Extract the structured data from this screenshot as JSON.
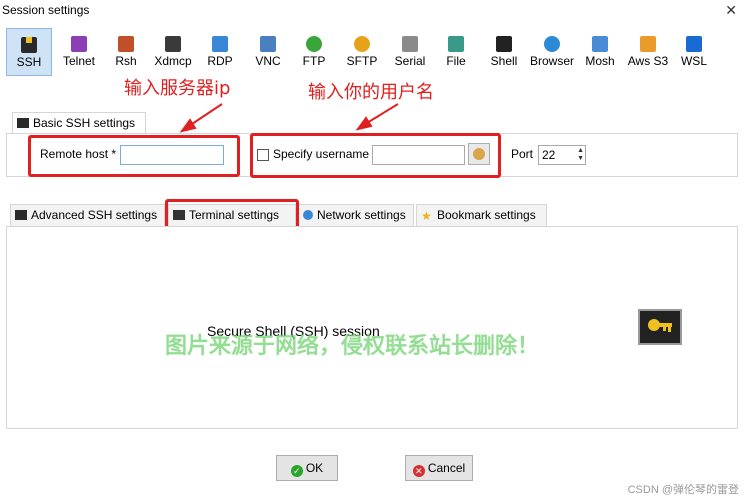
{
  "window": {
    "title": "Session settings",
    "close": "✕"
  },
  "session_types": [
    {
      "label": "SSH",
      "icon": "ssh-icon",
      "color": "#2a2a2a",
      "active": true
    },
    {
      "label": "Telnet",
      "icon": "telnet-icon",
      "color": "#8a3fb5"
    },
    {
      "label": "Rsh",
      "icon": "rsh-icon",
      "color": "#c0502a"
    },
    {
      "label": "Xdmcp",
      "icon": "xdmcp-icon",
      "color": "#3a3a3a"
    },
    {
      "label": "RDP",
      "icon": "rdp-icon",
      "color": "#3a86d6"
    },
    {
      "label": "VNC",
      "icon": "vnc-icon",
      "color": "#4a7fc0"
    },
    {
      "label": "FTP",
      "icon": "ftp-icon",
      "color": "#3aa53a"
    },
    {
      "label": "SFTP",
      "icon": "sftp-icon",
      "color": "#e8a21a"
    },
    {
      "label": "Serial",
      "icon": "serial-icon",
      "color": "#8a8a8a"
    },
    {
      "label": "File",
      "icon": "file-icon",
      "color": "#3a9a8a"
    },
    {
      "label": "Shell",
      "icon": "shell-icon",
      "color": "#222222"
    },
    {
      "label": "Browser",
      "icon": "browser-icon",
      "color": "#2a8ad6"
    },
    {
      "label": "Mosh",
      "icon": "mosh-icon",
      "color": "#4a8ad6"
    },
    {
      "label": "Aws S3",
      "icon": "aws-s3-icon",
      "color": "#e89a2a"
    },
    {
      "label": "WSL",
      "icon": "wsl-icon",
      "color": "#1a6ad6"
    }
  ],
  "annotations": {
    "server_ip": "输入服务器ip",
    "username": "输入你的用户名"
  },
  "basic_tab": {
    "label": "Basic SSH settings"
  },
  "basic": {
    "remote_host_label": "Remote host *",
    "remote_host_value": "",
    "specify_username_label": "Specify username",
    "username_value": "",
    "port_label": "Port",
    "port_value": "22"
  },
  "tabs": [
    {
      "label": "Advanced SSH settings"
    },
    {
      "label": "Terminal settings"
    },
    {
      "label": "Network settings"
    },
    {
      "label": "Bookmark settings"
    }
  ],
  "content": {
    "description": "Secure Shell (SSH) session"
  },
  "watermark": "图片来源于网络，侵权联系站长删除！",
  "buttons": {
    "ok": "OK",
    "cancel": "Cancel"
  },
  "footer": "CSDN @弹伦琴的雷登",
  "colors": {
    "accent_red": "#e02020",
    "active_tab_bg": "#cfe3f6"
  }
}
